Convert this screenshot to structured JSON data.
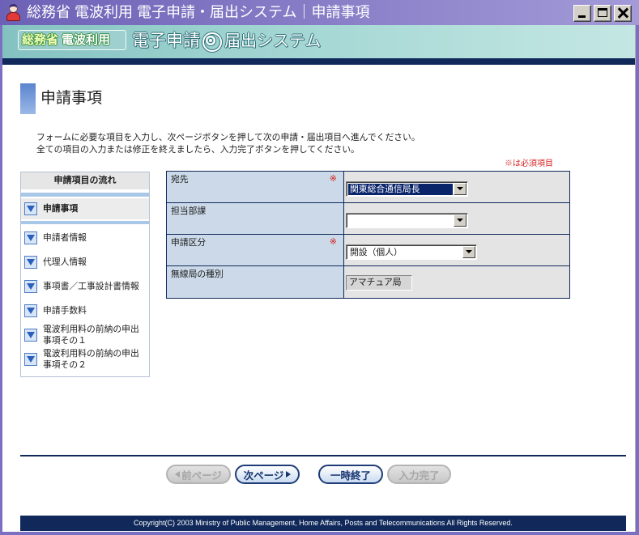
{
  "window": {
    "title": "総務省 電波利用 電子申請・届出システム｜申請事項",
    "icon": "mascot-icon",
    "controls": [
      "minimize-icon",
      "maximize-icon",
      "close-icon"
    ]
  },
  "banner": {
    "org": "総務省",
    "service": "電波利用",
    "system_left": "電子申請",
    "system_right": "届出システム",
    "emblem_icon": "radio-wave-icon"
  },
  "page": {
    "heading": "申請事項",
    "instructions": [
      "フォームに必要な項目を入力し、次ページボタンを押して次の申請・届出項目へ進んでください。",
      "全ての項目の入力または修正を終えましたら、入力完了ボタンを押してください。"
    ],
    "required_note": "※は必須項目"
  },
  "sidebar": {
    "title": "申請項目の流れ",
    "item_icon": "triangle-down-icon",
    "items": [
      {
        "label": "申請事項",
        "active": true
      },
      {
        "label": "申請者情報",
        "active": false
      },
      {
        "label": "代理人情報",
        "active": false
      },
      {
        "label": "事項書／工事設計書情報",
        "active": false
      },
      {
        "label": "申請手数料",
        "active": false
      },
      {
        "label": "電波利用料の前納の申出事項その１",
        "active": false
      },
      {
        "label": "電波利用料の前納の申出事項その２",
        "active": false
      }
    ]
  },
  "form": {
    "required_mark": "※",
    "rows": [
      {
        "label": "宛先",
        "required": true,
        "value": "関東総合通信局長",
        "highlighted": true
      },
      {
        "label": "担当部課",
        "required": false,
        "value": "",
        "highlighted": false
      },
      {
        "label": "申請区分",
        "required": true,
        "value": "開設（個人）",
        "highlighted": false
      },
      {
        "label": "無線局の種別",
        "required": false,
        "value": "アマチュア局",
        "readonly": true
      }
    ]
  },
  "buttons": {
    "prev": {
      "label": "前ページ",
      "icon": "arrow-left-icon",
      "disabled": true
    },
    "next": {
      "label": "次ページ",
      "icon": "arrow-right-icon",
      "disabled": false
    },
    "suspend": {
      "label": "一時終了",
      "disabled": false
    },
    "complete": {
      "label": "入力完了",
      "disabled": true
    }
  },
  "footer": {
    "copyright": "Copyright(C) 2003 Ministry of Public Management, Home Affairs, Posts and Telecommunications All Rights Reserved."
  },
  "colors": {
    "navy": "#10295a",
    "frame": "#7a70c2",
    "title_start": "#6c61b6",
    "title_end": "#a39ad8",
    "banner_start": "#84c2c1",
    "banner_end": "#c4e7e3",
    "label_cell": "#cbd9e8",
    "value_cell": "#e4e4e4",
    "required": "#d42020",
    "selection": "#0a246a",
    "stripe": "#a9c7e6",
    "button_face": "#d4d0c8"
  }
}
